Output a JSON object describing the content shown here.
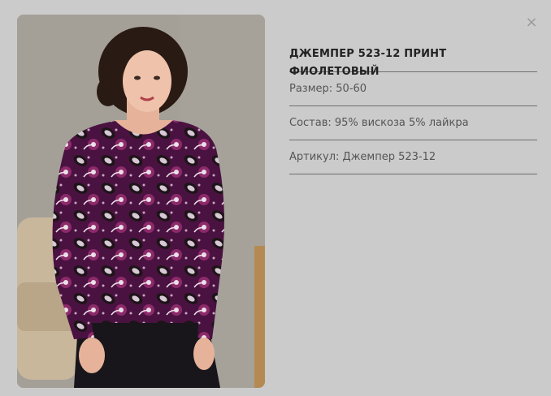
{
  "product": {
    "title": "ДЖЕМПЕР 523-12 ПРИНТ ФИОЛЕТОВЫЙ",
    "size": "Размер: 50-60",
    "composition": "Состав: 95% вискоза 5% лайкра",
    "article": "Артикул: Джемпер 523-12"
  },
  "close_glyph": "×",
  "image": {
    "subject": "model wearing purple paisley print jumper"
  },
  "colors": {
    "background": "#cbcbcb",
    "divider": "#6e6e6e",
    "jumper": "#5a1a4a"
  }
}
